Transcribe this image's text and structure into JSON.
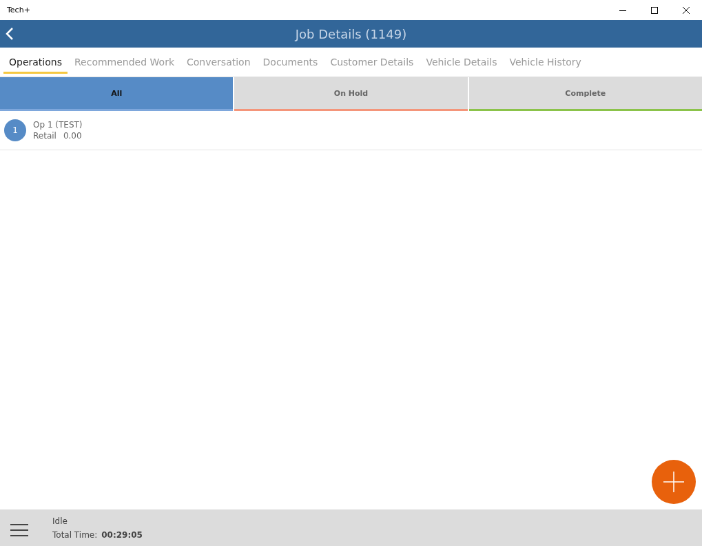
{
  "window": {
    "title": "Tech+"
  },
  "header": {
    "title": "Job Details (1149)"
  },
  "tabs": [
    {
      "label": "Operations",
      "selected": true
    },
    {
      "label": "Recommended Work",
      "selected": false
    },
    {
      "label": "Conversation",
      "selected": false
    },
    {
      "label": "Documents",
      "selected": false
    },
    {
      "label": "Customer Details",
      "selected": false
    },
    {
      "label": "Vehicle Details",
      "selected": false
    },
    {
      "label": "Vehicle History",
      "selected": false
    }
  ],
  "filters": [
    {
      "label": "All",
      "selected": true,
      "color": "#7ea7dc"
    },
    {
      "label": "On Hold",
      "selected": false,
      "color": "#f4957a"
    },
    {
      "label": "Complete",
      "selected": false,
      "color": "#8bc34a"
    }
  ],
  "operations": [
    {
      "number": "1",
      "name": "Op 1 (TEST)",
      "price_label": "Retail",
      "price": "0.00"
    }
  ],
  "status_bar": {
    "status": "Idle",
    "time_label": "Total Time:",
    "time": "00:29:05"
  }
}
